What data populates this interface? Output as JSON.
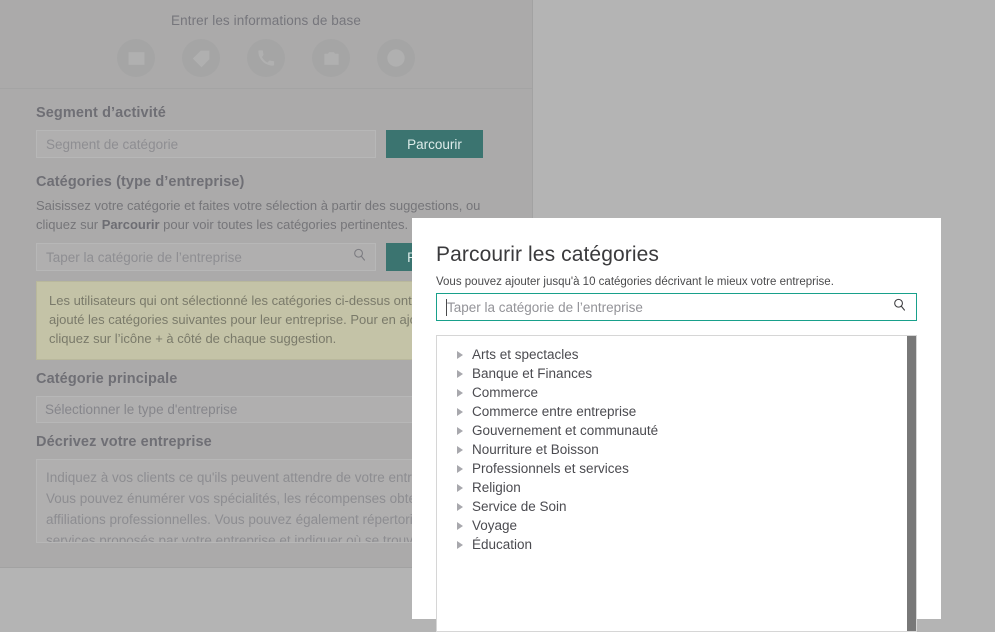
{
  "form": {
    "stepper": {
      "title": "Entrer les informations de base",
      "steps": [
        {
          "icon": "id-card-icon"
        },
        {
          "icon": "tag-icon"
        },
        {
          "icon": "phone-icon"
        },
        {
          "icon": "camera-icon"
        },
        {
          "icon": "clock-icon"
        }
      ]
    },
    "segment": {
      "label": "Segment d’activité",
      "input_placeholder": "Segment de catégorie",
      "browse_label": "Parcourir"
    },
    "categories": {
      "label": "Catégories (type d’entreprise)",
      "help_part1": "Saisissez votre catégorie et faites votre sélection à partir des suggestions, ou cliquez sur ",
      "help_bold": "Parcourir",
      "help_part2": " pour voir toutes les catégories pertinentes.",
      "input_placeholder": "Taper la catégorie de l’entreprise",
      "search_icon": "search-icon",
      "browse_label": "Parcourir",
      "suggestion_text": "Les utilisateurs qui ont sélectionné les catégories ci-dessus ont également ajouté les catégories suivantes pour leur entreprise. Pour en ajouter, cliquez sur l’icône + à côté de chaque suggestion."
    },
    "main_category": {
      "label": "Catégorie principale",
      "selected": "Sélectionner le type d'entreprise"
    },
    "description": {
      "label": "Décrivez votre entreprise",
      "placeholder": "Indiquez à vos clients ce qu'ils peuvent attendre de votre entreprise. Vous pouvez énumérer vos spécialités, les récompenses obtenues et vos affiliations professionnelles. Vous pouvez également répertorier les services proposés par votre entreprise et indiquer où se trouve votre entreprise dans la communauté."
    }
  },
  "modal": {
    "title": "Parcourir les catégories",
    "hint": "Vous pouvez ajouter jusqu'à 10 catégories décrivant le mieux votre entreprise.",
    "search_placeholder": "Taper la catégorie de l’entreprise",
    "search_icon": "search-icon",
    "accent_color": "#18a08b",
    "categories": [
      {
        "label": "Arts et spectacles",
        "expander": "chevron-right-icon"
      },
      {
        "label": "Banque et Finances",
        "expander": "chevron-right-icon"
      },
      {
        "label": "Commerce",
        "expander": "chevron-right-icon"
      },
      {
        "label": "Commerce entre entreprise",
        "expander": "chevron-right-icon"
      },
      {
        "label": "Gouvernement et communauté",
        "expander": "chevron-right-icon"
      },
      {
        "label": "Nourriture et Boisson",
        "expander": "chevron-right-icon"
      },
      {
        "label": "Professionnels et services",
        "expander": "chevron-right-icon"
      },
      {
        "label": "Religion",
        "expander": "chevron-right-icon"
      },
      {
        "label": "Service de Soin",
        "expander": "chevron-right-icon"
      },
      {
        "label": "Voyage",
        "expander": "chevron-right-icon"
      },
      {
        "label": "Éducation",
        "expander": "chevron-right-icon"
      }
    ]
  },
  "colors": {
    "page_background": "#b4b4b4",
    "card_background": "#abaaaa",
    "teal_button": "#3b7470",
    "suggestion_background": "#c4c3a7",
    "modal_accent": "#18a08b",
    "scrollbar_thumb": "#787878"
  }
}
